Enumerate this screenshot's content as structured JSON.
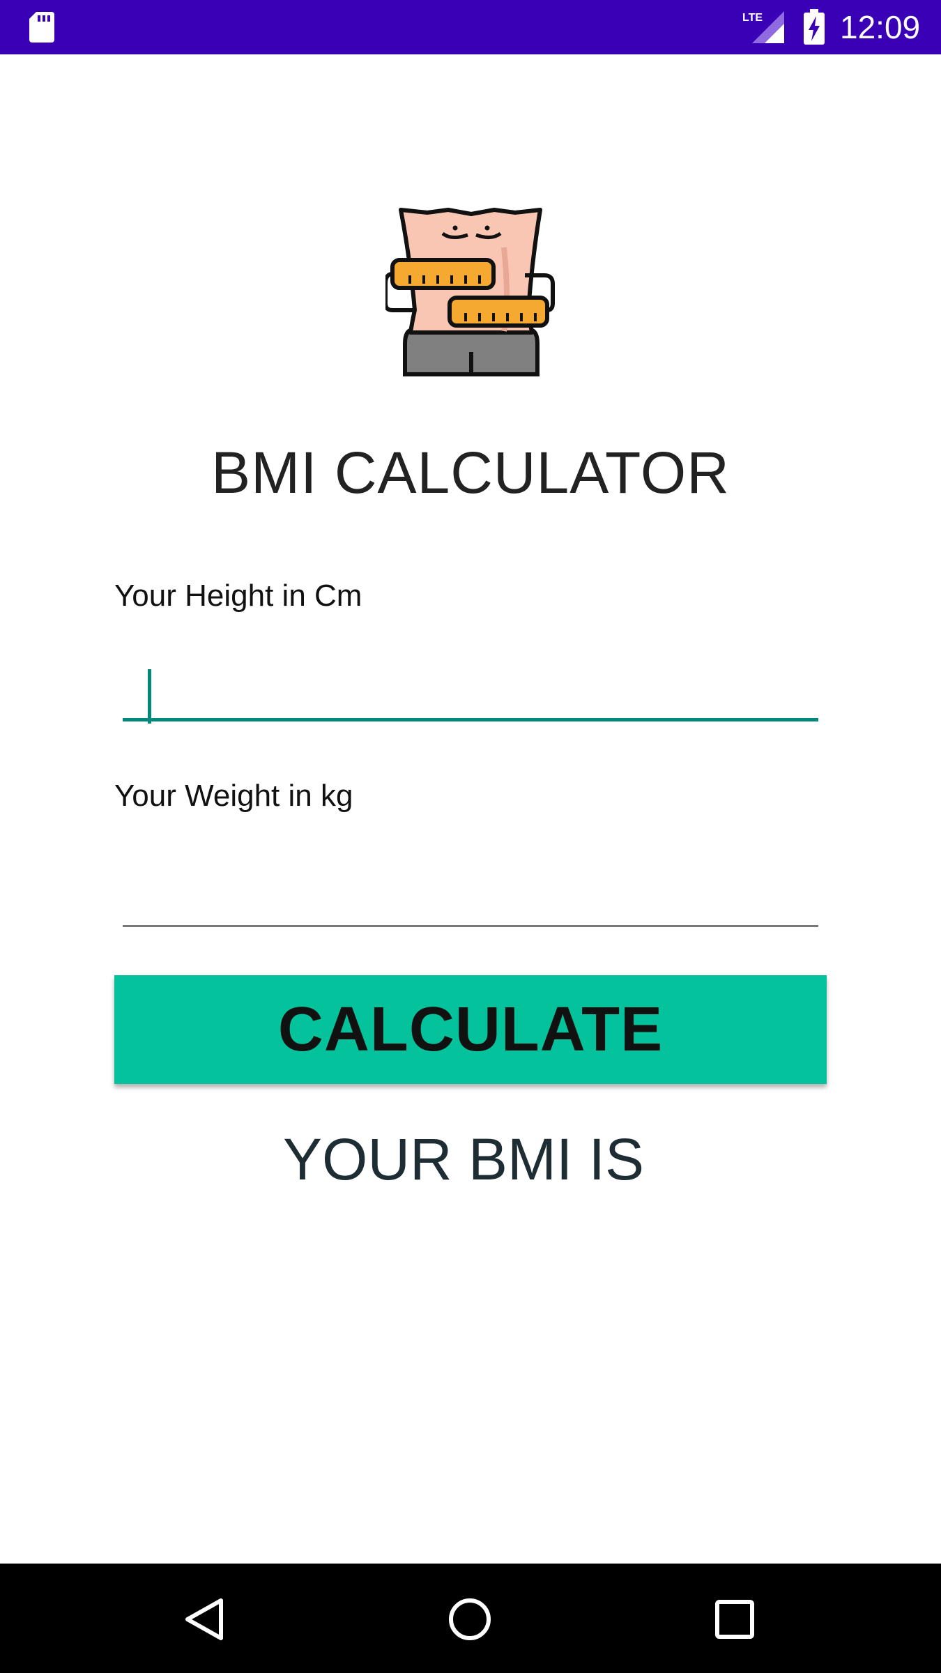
{
  "status_bar": {
    "time": "12:09",
    "network": "LTE",
    "icons": [
      "sd-card-icon",
      "lte-signal-icon",
      "battery-charging-icon"
    ],
    "background_color": "#3a00b5"
  },
  "app": {
    "logo_icon": "body-measuring-tape-icon",
    "title": "BMI CALCULATOR"
  },
  "form": {
    "height_label": "Your Height in Cm",
    "height_value": "",
    "weight_label": "Your Weight in kg",
    "weight_value": "",
    "accent_color": "#00897b"
  },
  "button": {
    "calculate_label": "CALCULATE",
    "color": "#04c29b"
  },
  "result": {
    "text": "YOUR BMI IS"
  },
  "nav_bar": {
    "icons": [
      "back-icon",
      "home-icon",
      "recents-icon"
    ]
  }
}
